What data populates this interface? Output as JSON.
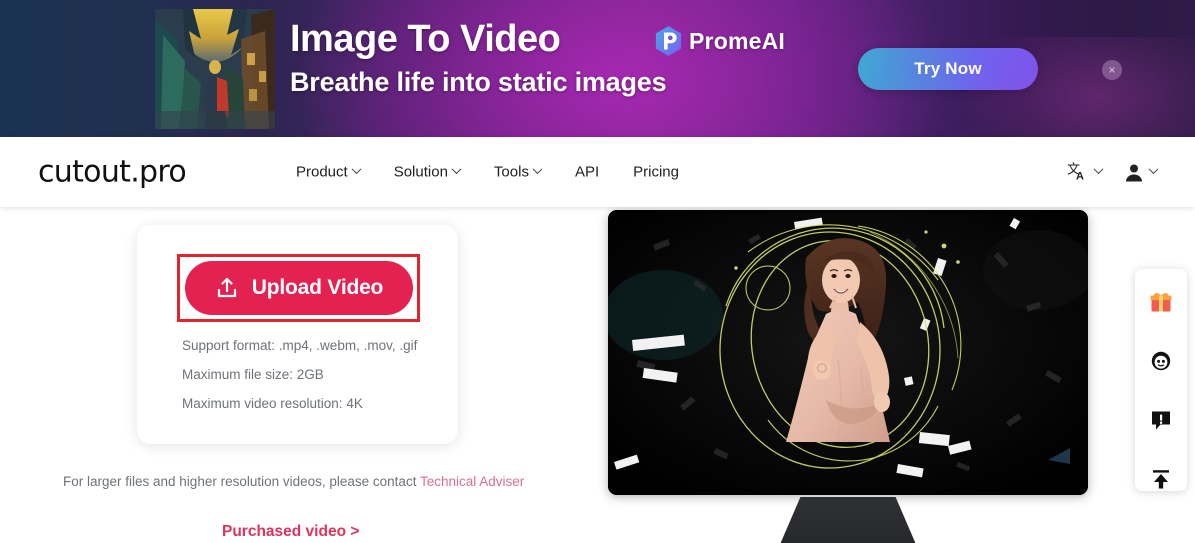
{
  "promo_banner": {
    "title": "Image To Video",
    "subtitle": "Breathe life into static images",
    "brand_name": "PromeAI",
    "cta_label": "Try Now",
    "close_label": "×",
    "thumbnail_alt": "image-to-video-sample-art",
    "colors": {
      "left": "#1b3352",
      "center": "#7d2a8e",
      "right": "#2e1b47",
      "cta_start": "#3fa9d4",
      "cta_end": "#7158f5"
    }
  },
  "navbar": {
    "logo": "cutout.pro",
    "links": [
      {
        "label": "Product",
        "has_dropdown": true
      },
      {
        "label": "Solution",
        "has_dropdown": true
      },
      {
        "label": "Tools",
        "has_dropdown": true
      },
      {
        "label": "API",
        "has_dropdown": false
      },
      {
        "label": "Pricing",
        "has_dropdown": false
      }
    ],
    "language_icon": "translate-icon",
    "account_icon": "user-icon"
  },
  "upload_card": {
    "button_label": "Upload Video",
    "button_icon": "upload-icon",
    "button_color": "#e32251",
    "highlight_border_color": "#e2242c",
    "specs": [
      "Support format: .mp4, .webm, .mov, .gif",
      "Maximum file size: 2GB",
      "Maximum video resolution: 4K"
    ]
  },
  "footer_note": {
    "text": "For larger files and higher resolution videos, please contact ",
    "link_label": "Technical Adviser",
    "link_color": "#d9708f",
    "purchased_link": "Purchased video >",
    "purchased_color": "#e0325c"
  },
  "video_preview": {
    "alt": "woman-dancing-on-dark-stage-with-light-trails",
    "device": "monitor"
  },
  "side_dock": {
    "items": [
      {
        "icon": "gift-icon",
        "label": "Gift"
      },
      {
        "icon": "support-face-icon",
        "label": "Support"
      },
      {
        "icon": "feedback-icon",
        "label": "Feedback"
      },
      {
        "icon": "back-to-top-icon",
        "label": "Back to top"
      }
    ]
  }
}
